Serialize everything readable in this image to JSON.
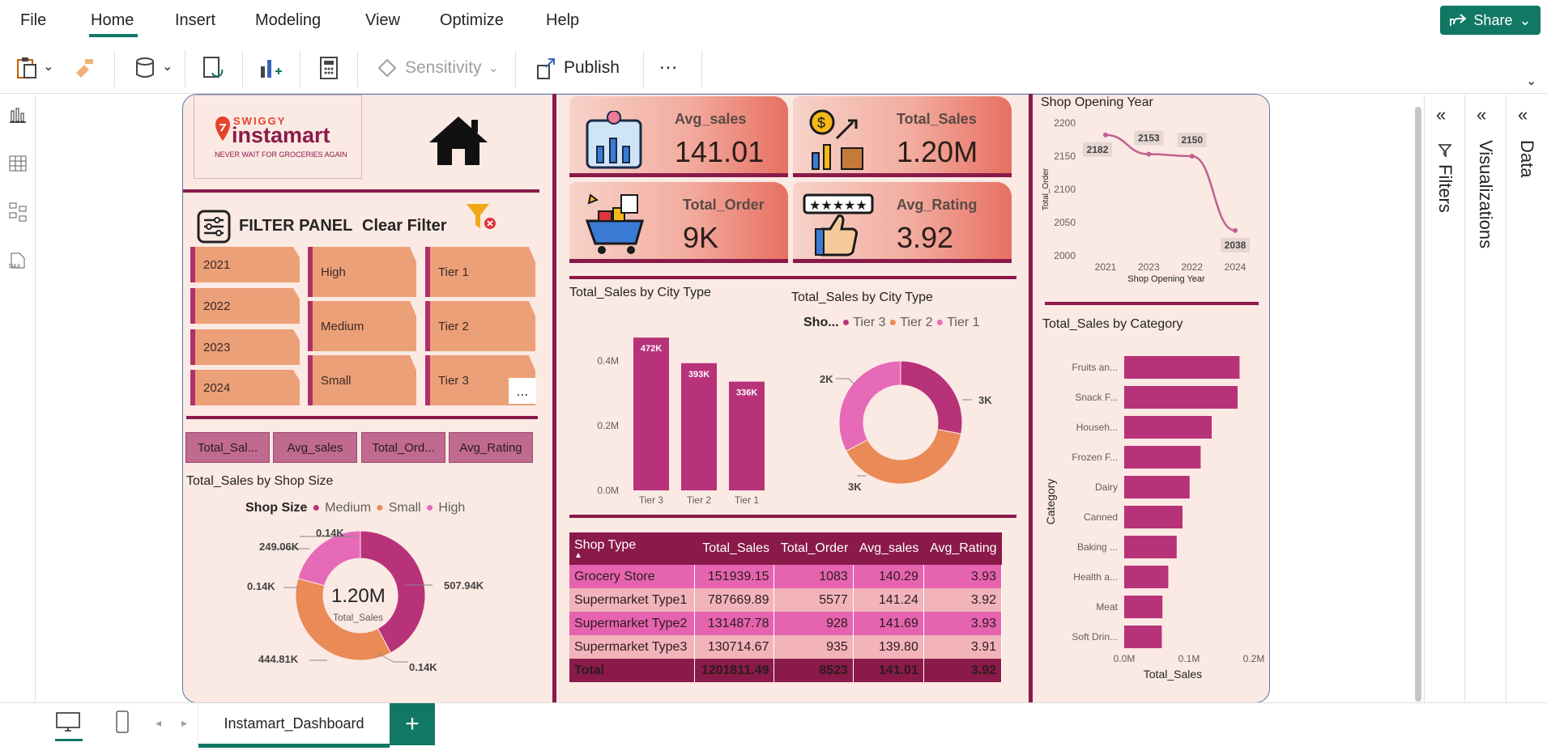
{
  "menu": {
    "items": [
      "File",
      "Home",
      "Insert",
      "Modeling",
      "View",
      "Optimize",
      "Help"
    ],
    "active": "Home",
    "share_label": "Share"
  },
  "toolbar": {
    "sensitivity_label": "Sensitivity",
    "publish_label": "Publish",
    "more_label": "..."
  },
  "header": {
    "logo_brand": "SWIGGY",
    "logo_name": "instamart",
    "logo_tagline": "NEVER WAIT FOR GROCERIES AGAIN"
  },
  "filter_panel": {
    "title": "FILTER PANEL",
    "clear_label": "Clear Filter",
    "years": [
      "2021",
      "2022",
      "2023",
      "2024"
    ],
    "sizes": [
      "High",
      "Medium",
      "Small"
    ],
    "tiers": [
      "Tier 1",
      "Tier 2",
      "Tier 3"
    ],
    "more_label": "..."
  },
  "measures": [
    "Total_Sal...",
    "Avg_sales",
    "Total_Ord...",
    "Avg_Rating"
  ],
  "kpis": [
    {
      "title": "Avg_sales",
      "value": "141.01"
    },
    {
      "title": "Total_Sales",
      "value": "1.20M"
    },
    {
      "title": "Total_Order",
      "value": "9K"
    },
    {
      "title": "Avg_Rating",
      "value": "3.92"
    }
  ],
  "donut_shop_size": {
    "title": "Total_Sales by Shop Size",
    "legend_title": "Shop Size",
    "legend": [
      "Medium",
      "Small",
      "High"
    ],
    "center_value": "1.20M",
    "center_label": "Total_Sales",
    "labels": [
      "507.94K",
      "444.81K",
      "249.06K",
      "0.14K",
      "0.14K",
      "0.14K"
    ]
  },
  "chart_data": [
    {
      "type": "bar",
      "title": "Total_Sales by City Type",
      "categories": [
        "Tier 3",
        "Tier 2",
        "Tier 1"
      ],
      "values": [
        472,
        393,
        336
      ],
      "data_labels": [
        "472K",
        "393K",
        "336K"
      ],
      "y_ticks": [
        "0.0M",
        "0.2M",
        "0.4M"
      ],
      "ylim": [
        0,
        0.5
      ]
    },
    {
      "type": "pie",
      "title": "Total_Sales by City Type",
      "legend_title": "Sho...",
      "categories": [
        "Tier 3",
        "Tier 2",
        "Tier 1"
      ],
      "values": [
        3,
        2,
        2
      ],
      "data_labels": [
        "3K",
        "3K",
        "2K"
      ],
      "colors": [
        "#b8327a",
        "#e98a57",
        "#e66ab8"
      ]
    },
    {
      "type": "line",
      "title": "Shop Opening Year",
      "xlabel": "Shop Opening Year",
      "ylabel": "Total_Order",
      "categories": [
        "2021",
        "2023",
        "2022",
        "2024"
      ],
      "values": [
        2182,
        2153,
        2150,
        2038
      ],
      "ylim": [
        2000,
        2200
      ],
      "y_ticks": [
        "2000",
        "2050",
        "2100",
        "2150",
        "2200"
      ]
    },
    {
      "type": "bar",
      "orientation": "horizontal",
      "title": "Total_Sales by Category",
      "xlabel": "Total_Sales",
      "ylabel": "Category",
      "categories": [
        "Fruits an...",
        "Snack F...",
        "Househ...",
        "Frozen F...",
        "Dairy",
        "Canned",
        "Baking ...",
        "Health a...",
        "Meat",
        "Soft Drin..."
      ],
      "values": [
        0.178,
        0.175,
        0.135,
        0.118,
        0.101,
        0.09,
        0.081,
        0.068,
        0.059,
        0.058
      ],
      "x_ticks": [
        "0.0M",
        "0.1M",
        "0.2M"
      ],
      "xlim": [
        0,
        0.2
      ]
    }
  ],
  "table": {
    "headers": [
      "Shop Type",
      "Total_Sales",
      "Total_Order",
      "Avg_sales",
      "Avg_Rating"
    ],
    "rows": [
      [
        "Grocery Store",
        "151939.15",
        "1083",
        "140.29",
        "3.93"
      ],
      [
        "Supermarket Type1",
        "787669.89",
        "5577",
        "141.24",
        "3.92"
      ],
      [
        "Supermarket Type2",
        "131487.78",
        "928",
        "141.69",
        "3.93"
      ],
      [
        "Supermarket Type3",
        "130714.67",
        "935",
        "139.80",
        "3.91"
      ]
    ],
    "total": [
      "Total",
      "1201811.49",
      "8523",
      "141.01",
      "3.92"
    ]
  },
  "right_panes": {
    "filters": "Filters",
    "visualizations": "Visualizations",
    "data": "Data"
  },
  "bottom": {
    "page_tab": "Instamart_Dashboard",
    "add_label": "+"
  },
  "colors": {
    "accent": "#8a1a4a",
    "bar": "#b8327a",
    "teal": "#117865",
    "bg": "#fbe9e3"
  }
}
